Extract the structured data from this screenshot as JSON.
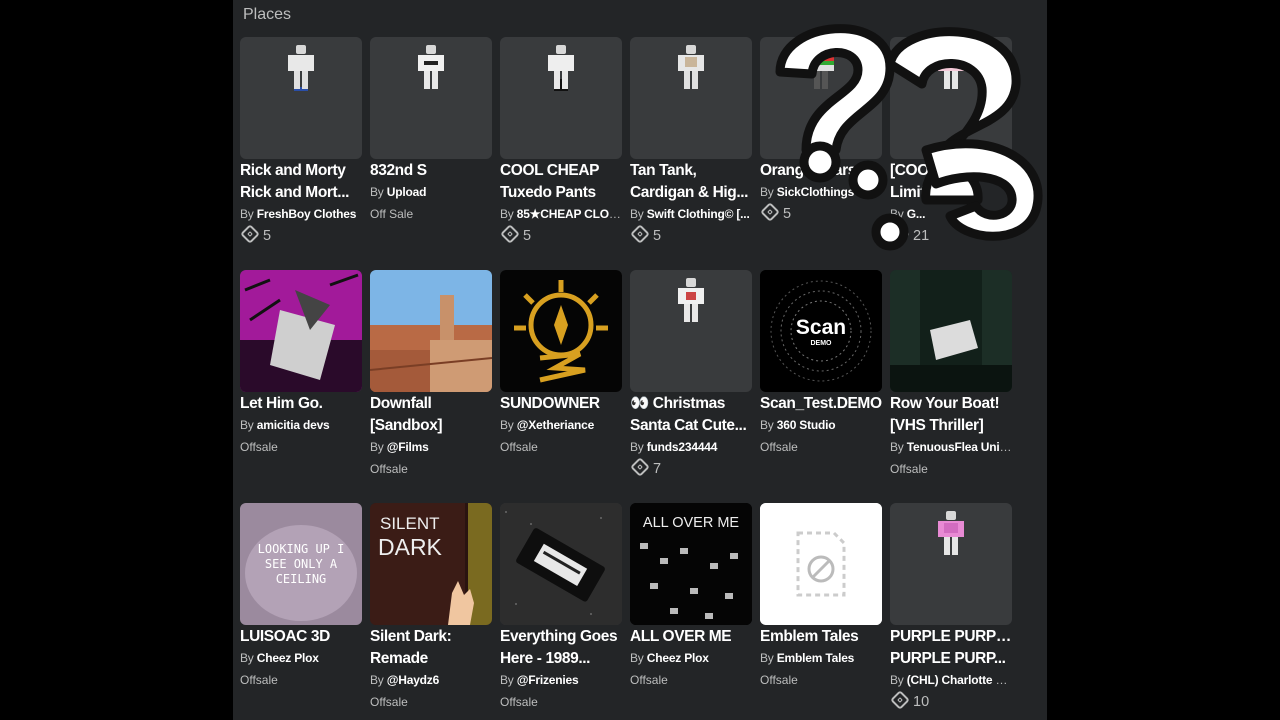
{
  "section": {
    "title": "Places"
  },
  "cards": [
    {
      "title1": "Rick and Morty",
      "title2": "Rick and Mort...",
      "by": "By",
      "creator": "FreshBoy Clothes",
      "price": "5",
      "thumb": "avatar-blue"
    },
    {
      "title1": "832nd S",
      "title2": "",
      "by": "By",
      "creator": "Upload",
      "status": "Off Sale",
      "thumb": "avatar-adidas"
    },
    {
      "title1": "COOL CHEAP",
      "title2": "Tuxedo Pants",
      "by": "By",
      "creator": "85★CHEAP CLOT...",
      "price": "5",
      "thumb": "avatar-black"
    },
    {
      "title1": "Tan Tank,",
      "title2": "Cardigan & Hig...",
      "by": "By",
      "creator": "Swift Clothing© [...",
      "price": "5",
      "thumb": "avatar-tan"
    },
    {
      "title1": "Orange Scars",
      "title2": "",
      "by": "By",
      "creator": "SickClothings",
      "price": "5",
      "thumb": "avatar-rainbow"
    },
    {
      "title1": "[COOL] 🎃 🍬 🍭",
      "title2": "Limited 🔥 ...",
      "by": "By",
      "creator": "G...",
      "price": "21",
      "thumb": "avatar-pink"
    },
    {
      "title1": "Let Him Go.",
      "title2": "",
      "by": "By",
      "creator": "amicitia devs",
      "status": "Offsale",
      "thumb": "art-pink"
    },
    {
      "title1": "Downfall",
      "title2": "[Sandbox]",
      "by": "By",
      "creator": "@Films",
      "status": "Offsale",
      "thumb": "art-city"
    },
    {
      "title1": "SUNDOWNER",
      "title2": "",
      "by": "By",
      "creator": "@Xetheriance",
      "status": "Offsale",
      "thumb": "art-sun"
    },
    {
      "title1": "👀 Christmas",
      "title2": "Santa Cat Cute...",
      "by": "By",
      "creator": "funds234444",
      "price": "7",
      "thumb": "avatar-santa"
    },
    {
      "title1": "Scan_Test.DEMO",
      "title2": "",
      "by": "By",
      "creator": "360 Studio",
      "status": "Offsale",
      "thumb": "art-scan",
      "thumb_text": "Scan",
      "thumb_sub": "DEMO"
    },
    {
      "title1": "Row Your Boat!",
      "title2": "[VHS Thriller]",
      "by": "By",
      "creator": "TenuousFlea Univ...",
      "status": "Offsale",
      "thumb": "art-boat"
    },
    {
      "title1": "LUISOAC 3D",
      "title2": "",
      "by": "By",
      "creator": "Cheez Plox",
      "status": "Offsale",
      "thumb": "art-ceiling",
      "thumb_text": "LOOKING UP I SEE ONLY A CEILING"
    },
    {
      "title1": "Silent Dark:",
      "title2": "Remade",
      "by": "By",
      "creator": "@Haydz6",
      "status": "Offsale",
      "thumb": "art-silent",
      "thumb_text": "SILENT",
      "thumb_sub": "DARK"
    },
    {
      "title1": "Everything Goes",
      "title2": "Here - 1989...",
      "by": "By",
      "creator": "@Frizenies",
      "status": "Offsale",
      "thumb": "art-tape"
    },
    {
      "title1": "ALL OVER ME",
      "title2": "",
      "by": "By",
      "creator": "Cheez Plox",
      "status": "Offsale",
      "thumb": "art-allover",
      "thumb_text": "ALL OVER ME"
    },
    {
      "title1": "Emblem Tales",
      "title2": "",
      "by": "By",
      "creator": "Emblem Tales",
      "status": "Offsale",
      "thumb": "placeholder"
    },
    {
      "title1": "PURPLE PURPLE",
      "title2": "PURPLE PURP...",
      "by": "By",
      "creator": "(CHL) Charlotte C...",
      "price": "10",
      "thumb": "avatar-purple"
    }
  ],
  "overlay": {
    "glyph": "?"
  }
}
